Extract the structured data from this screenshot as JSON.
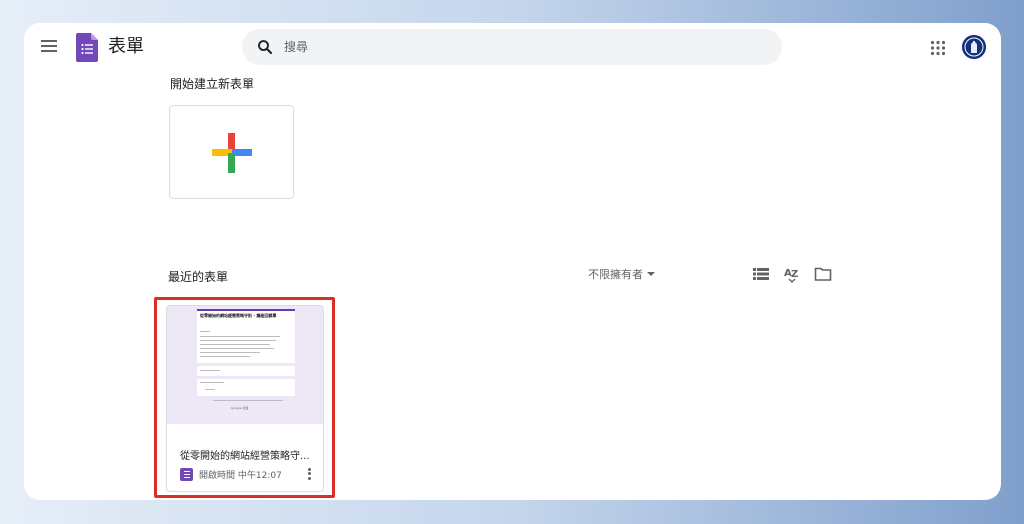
{
  "header": {
    "app_title": "表單",
    "search_placeholder": "搜尋"
  },
  "start_section": {
    "label": "開始建立新表單"
  },
  "recent_section": {
    "label": "最近的表單",
    "owner_filter": "不限擁有者"
  },
  "recent_forms": [
    {
      "title": "從零開始的網站經營策略守...",
      "meta": "開啟時間 中午12:07",
      "thumbnail": {
        "form_title": "從零開始的網站經營策略守則 - 講座回饋單",
        "footer": "Google 表單"
      }
    }
  ],
  "colors": {
    "forms_purple": "#7248b9",
    "highlight_red": "#d93025",
    "plus_red": "#ea4335",
    "plus_blue": "#4285f4",
    "plus_yellow": "#fbbc04",
    "plus_green": "#34a853"
  },
  "icons": [
    "menu-icon",
    "forms-logo-icon",
    "search-icon",
    "apps-grid-icon",
    "avatar",
    "plus-icon",
    "list-view-icon",
    "sort-az-icon",
    "folder-icon",
    "more-vert-icon"
  ]
}
